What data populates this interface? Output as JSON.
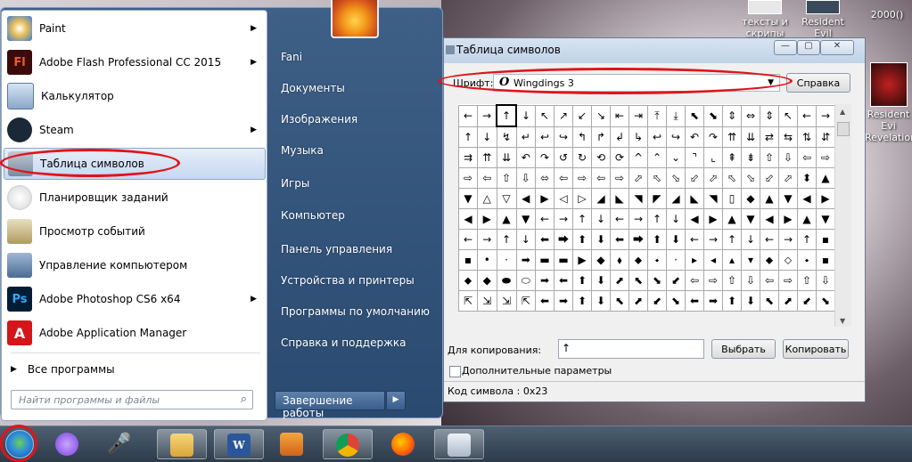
{
  "desktop": {
    "icons": [
      {
        "label": "тексты и скрипы"
      },
      {
        "label": "Resident Evil Revelation"
      },
      {
        "label": "2000()"
      },
      {
        "label": "Resident Evi Revelation"
      }
    ]
  },
  "start_menu": {
    "programs": [
      {
        "label": "Paint",
        "has_submenu": true
      },
      {
        "label": "Adobe Flash Professional CC 2015",
        "has_submenu": true
      },
      {
        "label": "Калькулятор",
        "has_submenu": false
      },
      {
        "label": "Steam",
        "has_submenu": true
      },
      {
        "label": "Таблица символов",
        "has_submenu": false,
        "selected": true
      },
      {
        "label": "Планировщик заданий",
        "has_submenu": false
      },
      {
        "label": "Просмотр событий",
        "has_submenu": false
      },
      {
        "label": "Управление компьютером",
        "has_submenu": false
      },
      {
        "label": "Adobe Photoshop CS6 x64",
        "has_submenu": true
      },
      {
        "label": "Adobe Application Manager",
        "has_submenu": false
      }
    ],
    "flash_icon_text": "Fl",
    "ps_icon_text": "Ps",
    "all_programs": "Все программы",
    "search_placeholder": "Найти программы и файлы",
    "right_items": [
      "Fani",
      "Документы",
      "Изображения",
      "Музыка",
      "Игры",
      "Компьютер",
      "Панель управления",
      "Устройства и принтеры",
      "Программы по умолчанию",
      "Справка и поддержка"
    ],
    "shutdown": "Завершение работы"
  },
  "charmap": {
    "title": "Таблица символов",
    "font_label": "Шрифт:",
    "font_value": "Wingdings 3",
    "help_button": "Справка",
    "grid": [
      [
        "←",
        "→",
        "↑",
        "↓",
        "↖",
        "↗",
        "↙",
        "↘",
        "⇤",
        "⇥",
        "⤒",
        "⤓",
        "⬉",
        "⬊",
        "⇕",
        "⇔",
        "⇕",
        "↖",
        "←",
        "→"
      ],
      [
        "↑",
        "↓",
        "↯",
        "↵",
        "↩",
        "↪",
        "↰",
        "↱",
        "↲",
        "↳",
        "↩",
        "↪",
        "↶",
        "↷",
        "⇈",
        "⇊",
        "⇄",
        "⇆",
        "⇅",
        "⇵"
      ],
      [
        "⇉",
        "⇈",
        "⇊",
        "↶",
        "↷",
        "↺",
        "↻",
        "⟲",
        "⟳",
        "^",
        "⌃",
        "⌄",
        "⌝",
        "⌞",
        "⇞",
        "⇟",
        "⇧",
        "⇩",
        "⇦",
        "⇨"
      ],
      [
        "⇨",
        "⇦",
        "⇧",
        "⇩",
        "⬄",
        "⇦",
        "⇨",
        "⇦",
        "⇨",
        "⬀",
        "⬁",
        "⬂",
        "⬃",
        "⬀",
        "⬁",
        "⬂",
        "⬃",
        "⬀",
        "⬍",
        "▲"
      ],
      [
        "▼",
        "△",
        "▽",
        "◀",
        "▶",
        "◁",
        "▷",
        "◢",
        "◣",
        "◥",
        "◤",
        "◢",
        "◣",
        "◥",
        "▯",
        "◆",
        "▲",
        "▼",
        "◀",
        "▶"
      ],
      [
        "◀",
        "▶",
        "▲",
        "▼",
        "←",
        "→",
        "↑",
        "↓",
        "←",
        "→",
        "↑",
        "↓",
        "◀",
        "▶",
        "▲",
        "▼",
        "◀",
        "▶",
        "▲",
        "▼"
      ],
      [
        "←",
        "→",
        "↑",
        "↓",
        "⬅",
        "⮕",
        "⬆",
        "⬇",
        "⬅",
        "⮕",
        "⬆",
        "⬇",
        "←",
        "→",
        "↑",
        "↓",
        "←",
        "→",
        "↑",
        "▪"
      ],
      [
        "▪",
        "•",
        "·",
        "➡",
        "▬",
        "▬",
        "▶",
        "◆",
        "⬧",
        "⬥",
        "⬩",
        "·",
        "▸",
        "◂",
        "▴",
        "▾",
        "⬥",
        "⬦",
        "⬩",
        "▪"
      ],
      [
        "⬥",
        "◆",
        "⬬",
        "⬭",
        "➡",
        "⬅",
        "⬆",
        "⬇",
        "⬈",
        "⬉",
        "⬊",
        "⬋",
        "⇦",
        "⇨",
        "⇧",
        "⇩",
        "⇦",
        "⇨",
        "⇧",
        "⇩"
      ],
      [
        "⇱",
        "⇲",
        "⇲",
        "⇱",
        "⬅",
        "➡",
        "⬆",
        "⬇",
        "⬉",
        "⬈",
        "⬋",
        "⬊",
        "⬅",
        "➡",
        "⬆",
        "⬇",
        "⬉",
        "⬈",
        "⬋",
        "⬊"
      ]
    ],
    "copy_label": "Для копирования:",
    "copy_value": "↑",
    "select_button": "Выбрать",
    "copy_button": "Копировать",
    "advanced_label": "Дополнительные параметры",
    "status": "Код символа : 0x23"
  },
  "colors": {
    "annotation_red": "#e0141b",
    "menu_blue": "#2a4a70"
  }
}
